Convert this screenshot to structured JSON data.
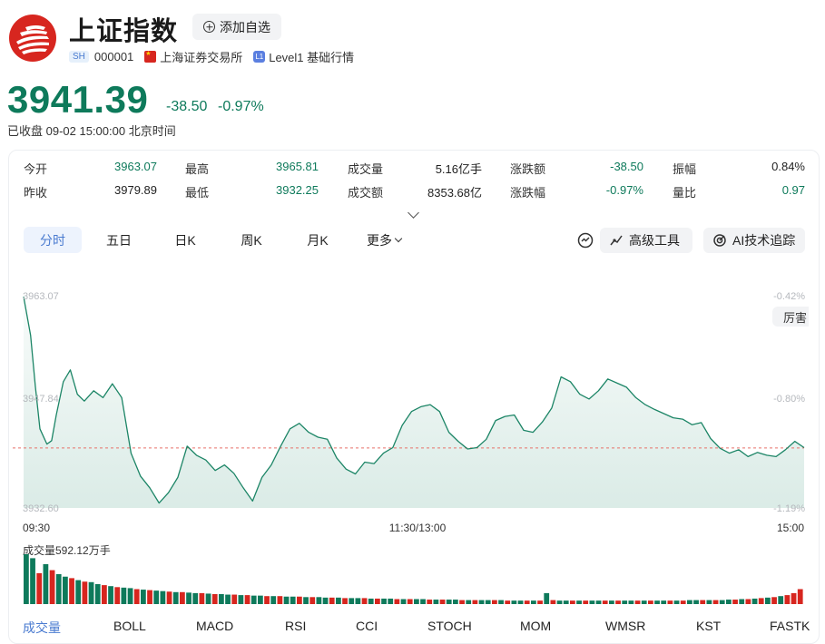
{
  "header": {
    "title": "上证指数",
    "watch_label": "添加自选",
    "market_badge": "SH",
    "code": "000001",
    "exchange": "上海证券交易所",
    "level_badge": "L1",
    "level_text": "Level1 基础行情"
  },
  "quote": {
    "price": "3941.39",
    "change": "-38.50",
    "change_pct": "-0.97%",
    "status": "已收盘  09-02 15:00:00  北京时间"
  },
  "stats": [
    {
      "label": "今开",
      "value": "3963.07",
      "tone": "down"
    },
    {
      "label": "最高",
      "value": "3965.81",
      "tone": "down"
    },
    {
      "label": "成交量",
      "value": "5.16亿手",
      "tone": "neutral"
    },
    {
      "label": "涨跌额",
      "value": "-38.50",
      "tone": "down"
    },
    {
      "label": "振幅",
      "value": "0.84%",
      "tone": "neutral"
    },
    {
      "label": "昨收",
      "value": "3979.89",
      "tone": "neutral"
    },
    {
      "label": "最低",
      "value": "3932.25",
      "tone": "down"
    },
    {
      "label": "成交额",
      "value": "8353.68亿",
      "tone": "neutral"
    },
    {
      "label": "涨跌幅",
      "value": "-0.97%",
      "tone": "down"
    },
    {
      "label": "量比",
      "value": "0.97",
      "tone": "down"
    }
  ],
  "period_tabs": [
    {
      "label": "分时",
      "active": true
    },
    {
      "label": "五日",
      "active": false
    },
    {
      "label": "日K",
      "active": false
    },
    {
      "label": "周K",
      "active": false
    },
    {
      "label": "月K",
      "active": false
    },
    {
      "label": "更多",
      "active": false,
      "dropdown": true
    }
  ],
  "tools": {
    "advanced_label": "高级工具",
    "ai_label": "AI技术追踪",
    "side_tag": "厉害"
  },
  "colors": {
    "down": "#0e7a5b",
    "up": "#d7261f",
    "accent": "#4a7bd0",
    "line": "#1c8566",
    "baseline": "#e8706a"
  },
  "chart_data": {
    "type": "line",
    "title": "",
    "y_left_ticks": [
      "3963.07",
      "3947.84",
      "3932.60"
    ],
    "y_right_ticks": [
      "-0.42%",
      "-0.80%",
      "-1.19%"
    ],
    "ylim": [
      3932.6,
      3963.07
    ],
    "prev_close": 3979.89,
    "baseline_value": 3941.25,
    "x_tick_labels": [
      "09:30",
      "11:30/13:00",
      "15:00"
    ],
    "x_count": 241,
    "series": [
      {
        "points": [
          [
            0,
            3963.07
          ],
          [
            3,
            3957.5
          ],
          [
            5,
            3950.2
          ],
          [
            7,
            3944.0
          ],
          [
            10,
            3941.8
          ],
          [
            12,
            3942.3
          ],
          [
            14,
            3946.0
          ],
          [
            17,
            3950.8
          ],
          [
            20,
            3952.5
          ],
          [
            23,
            3949.0
          ],
          [
            26,
            3948.0
          ],
          [
            30,
            3949.5
          ],
          [
            34,
            3948.5
          ],
          [
            38,
            3950.5
          ],
          [
            42,
            3948.5
          ],
          [
            46,
            3940.5
          ],
          [
            50,
            3937.2
          ],
          [
            54,
            3935.5
          ],
          [
            58,
            3933.3
          ],
          [
            62,
            3934.8
          ],
          [
            66,
            3937.0
          ],
          [
            70,
            3941.5
          ],
          [
            74,
            3940.2
          ],
          [
            78,
            3939.5
          ],
          [
            82,
            3938.0
          ],
          [
            86,
            3938.8
          ],
          [
            90,
            3937.6
          ],
          [
            94,
            3935.5
          ],
          [
            98,
            3933.6
          ],
          [
            102,
            3937.0
          ],
          [
            106,
            3938.8
          ],
          [
            110,
            3941.5
          ],
          [
            114,
            3944.0
          ],
          [
            118,
            3944.8
          ],
          [
            122,
            3943.5
          ],
          [
            126,
            3942.8
          ],
          [
            130,
            3942.5
          ],
          [
            134,
            3939.8
          ],
          [
            138,
            3938.2
          ],
          [
            142,
            3937.5
          ],
          [
            146,
            3939.2
          ],
          [
            150,
            3939.0
          ],
          [
            154,
            3940.5
          ],
          [
            158,
            3941.3
          ],
          [
            162,
            3944.5
          ],
          [
            166,
            3946.5
          ],
          [
            170,
            3947.2
          ],
          [
            174,
            3947.5
          ],
          [
            178,
            3946.5
          ],
          [
            182,
            3943.5
          ],
          [
            186,
            3942.2
          ],
          [
            190,
            3941.1
          ],
          [
            194,
            3941.3
          ],
          [
            198,
            3942.5
          ],
          [
            202,
            3945.2
          ],
          [
            206,
            3945.8
          ],
          [
            210,
            3946.0
          ],
          [
            214,
            3943.8
          ],
          [
            218,
            3943.5
          ],
          [
            222,
            3945.0
          ],
          [
            226,
            3947.0
          ],
          [
            230,
            3951.5
          ],
          [
            234,
            3950.8
          ],
          [
            238,
            3949.0
          ],
          [
            242,
            3948.3
          ],
          [
            246,
            3949.5
          ],
          [
            250,
            3951.2
          ],
          [
            254,
            3950.6
          ],
          [
            258,
            3950.0
          ],
          [
            262,
            3948.5
          ],
          [
            266,
            3947.5
          ],
          [
            270,
            3946.8
          ],
          [
            274,
            3946.2
          ],
          [
            278,
            3945.6
          ],
          [
            282,
            3945.4
          ],
          [
            286,
            3944.6
          ],
          [
            290,
            3944.9
          ],
          [
            294,
            3942.6
          ],
          [
            298,
            3941.2
          ],
          [
            302,
            3940.5
          ],
          [
            306,
            3941.0
          ],
          [
            310,
            3940.0
          ],
          [
            314,
            3940.6
          ],
          [
            318,
            3940.2
          ],
          [
            322,
            3940.0
          ],
          [
            326,
            3941.0
          ],
          [
            330,
            3942.2
          ],
          [
            334,
            3941.3
          ]
        ]
      }
    ],
    "volume": {
      "label": "成交量592.12万手",
      "bars": [
        {
          "v": 100,
          "c": "down"
        },
        {
          "v": 92,
          "c": "down"
        },
        {
          "v": 62,
          "c": "up"
        },
        {
          "v": 80,
          "c": "down"
        },
        {
          "v": 68,
          "c": "up"
        },
        {
          "v": 60,
          "c": "down"
        },
        {
          "v": 55,
          "c": "down"
        },
        {
          "v": 52,
          "c": "up"
        },
        {
          "v": 48,
          "c": "down"
        },
        {
          "v": 45,
          "c": "up"
        },
        {
          "v": 44,
          "c": "down"
        },
        {
          "v": 40,
          "c": "down"
        },
        {
          "v": 38,
          "c": "up"
        },
        {
          "v": 36,
          "c": "down"
        },
        {
          "v": 34,
          "c": "up"
        },
        {
          "v": 33,
          "c": "down"
        },
        {
          "v": 32,
          "c": "down"
        },
        {
          "v": 30,
          "c": "up"
        },
        {
          "v": 29,
          "c": "down"
        },
        {
          "v": 28,
          "c": "up"
        },
        {
          "v": 27,
          "c": "down"
        },
        {
          "v": 26,
          "c": "down"
        },
        {
          "v": 25,
          "c": "up"
        },
        {
          "v": 24,
          "c": "down"
        },
        {
          "v": 24,
          "c": "up"
        },
        {
          "v": 23,
          "c": "down"
        },
        {
          "v": 22,
          "c": "down"
        },
        {
          "v": 22,
          "c": "up"
        },
        {
          "v": 21,
          "c": "down"
        },
        {
          "v": 20,
          "c": "up"
        },
        {
          "v": 20,
          "c": "down"
        },
        {
          "v": 19,
          "c": "down"
        },
        {
          "v": 19,
          "c": "up"
        },
        {
          "v": 18,
          "c": "down"
        },
        {
          "v": 18,
          "c": "up"
        },
        {
          "v": 17,
          "c": "down"
        },
        {
          "v": 17,
          "c": "down"
        },
        {
          "v": 16,
          "c": "up"
        },
        {
          "v": 16,
          "c": "down"
        },
        {
          "v": 16,
          "c": "up"
        },
        {
          "v": 15,
          "c": "down"
        },
        {
          "v": 15,
          "c": "down"
        },
        {
          "v": 15,
          "c": "up"
        },
        {
          "v": 14,
          "c": "down"
        },
        {
          "v": 14,
          "c": "up"
        },
        {
          "v": 14,
          "c": "down"
        },
        {
          "v": 13,
          "c": "down"
        },
        {
          "v": 13,
          "c": "up"
        },
        {
          "v": 13,
          "c": "down"
        },
        {
          "v": 12,
          "c": "up"
        },
        {
          "v": 12,
          "c": "down"
        },
        {
          "v": 12,
          "c": "down"
        },
        {
          "v": 12,
          "c": "up"
        },
        {
          "v": 11,
          "c": "down"
        },
        {
          "v": 11,
          "c": "up"
        },
        {
          "v": 11,
          "c": "down"
        },
        {
          "v": 11,
          "c": "down"
        },
        {
          "v": 10,
          "c": "up"
        },
        {
          "v": 10,
          "c": "down"
        },
        {
          "v": 10,
          "c": "up"
        },
        {
          "v": 10,
          "c": "down"
        },
        {
          "v": 10,
          "c": "down"
        },
        {
          "v": 9,
          "c": "up"
        },
        {
          "v": 9,
          "c": "down"
        },
        {
          "v": 9,
          "c": "up"
        },
        {
          "v": 9,
          "c": "down"
        },
        {
          "v": 9,
          "c": "down"
        },
        {
          "v": 8,
          "c": "up"
        },
        {
          "v": 8,
          "c": "down"
        },
        {
          "v": 8,
          "c": "up"
        },
        {
          "v": 8,
          "c": "down"
        },
        {
          "v": 8,
          "c": "down"
        },
        {
          "v": 8,
          "c": "up"
        },
        {
          "v": 8,
          "c": "down"
        },
        {
          "v": 7,
          "c": "up"
        },
        {
          "v": 7,
          "c": "down"
        },
        {
          "v": 7,
          "c": "down"
        },
        {
          "v": 7,
          "c": "up"
        },
        {
          "v": 7,
          "c": "down"
        },
        {
          "v": 7,
          "c": "up"
        },
        {
          "v": 22,
          "c": "down"
        },
        {
          "v": 8,
          "c": "up"
        },
        {
          "v": 7,
          "c": "down"
        },
        {
          "v": 7,
          "c": "down"
        },
        {
          "v": 7,
          "c": "up"
        },
        {
          "v": 7,
          "c": "down"
        },
        {
          "v": 7,
          "c": "up"
        },
        {
          "v": 7,
          "c": "down"
        },
        {
          "v": 7,
          "c": "down"
        },
        {
          "v": 7,
          "c": "up"
        },
        {
          "v": 7,
          "c": "down"
        },
        {
          "v": 7,
          "c": "up"
        },
        {
          "v": 7,
          "c": "down"
        },
        {
          "v": 7,
          "c": "down"
        },
        {
          "v": 7,
          "c": "up"
        },
        {
          "v": 7,
          "c": "down"
        },
        {
          "v": 7,
          "c": "up"
        },
        {
          "v": 7,
          "c": "down"
        },
        {
          "v": 7,
          "c": "down"
        },
        {
          "v": 7,
          "c": "up"
        },
        {
          "v": 7,
          "c": "down"
        },
        {
          "v": 7,
          "c": "up"
        },
        {
          "v": 8,
          "c": "down"
        },
        {
          "v": 8,
          "c": "down"
        },
        {
          "v": 8,
          "c": "up"
        },
        {
          "v": 8,
          "c": "down"
        },
        {
          "v": 8,
          "c": "up"
        },
        {
          "v": 8,
          "c": "down"
        },
        {
          "v": 9,
          "c": "down"
        },
        {
          "v": 9,
          "c": "up"
        },
        {
          "v": 10,
          "c": "down"
        },
        {
          "v": 10,
          "c": "up"
        },
        {
          "v": 11,
          "c": "down"
        },
        {
          "v": 12,
          "c": "up"
        },
        {
          "v": 13,
          "c": "down"
        },
        {
          "v": 14,
          "c": "up"
        },
        {
          "v": 16,
          "c": "down"
        },
        {
          "v": 18,
          "c": "up"
        },
        {
          "v": 22,
          "c": "up"
        },
        {
          "v": 30,
          "c": "up"
        }
      ]
    }
  },
  "indicators": [
    {
      "label": "成交量",
      "active": true
    },
    {
      "label": "BOLL",
      "active": false
    },
    {
      "label": "MACD",
      "active": false
    },
    {
      "label": "RSI",
      "active": false
    },
    {
      "label": "CCI",
      "active": false
    },
    {
      "label": "STOCH",
      "active": false
    },
    {
      "label": "MOM",
      "active": false
    },
    {
      "label": "WMSR",
      "active": false
    },
    {
      "label": "KST",
      "active": false
    },
    {
      "label": "FASTK",
      "active": false
    }
  ]
}
